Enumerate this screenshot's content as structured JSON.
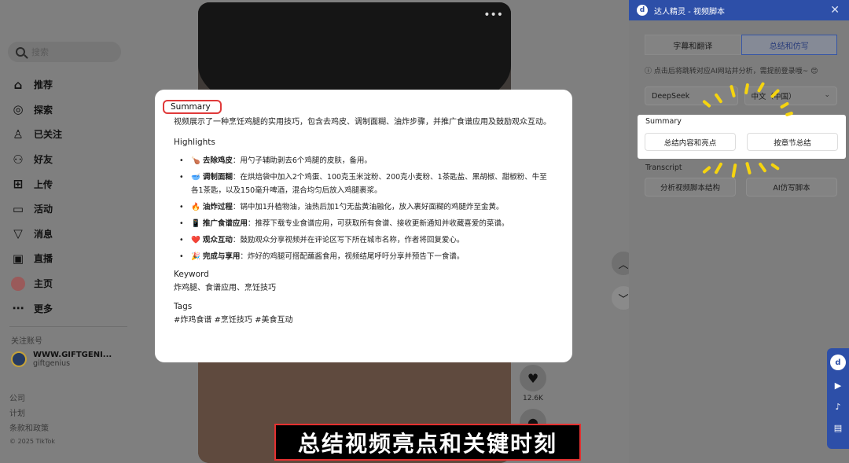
{
  "tiktok": {
    "search_placeholder": "搜索",
    "nav": [
      {
        "icon": "home-icon",
        "label": "推荐"
      },
      {
        "icon": "compass-icon",
        "label": "探索"
      },
      {
        "icon": "following-icon",
        "label": "已关注"
      },
      {
        "icon": "friends-icon",
        "label": "好友"
      },
      {
        "icon": "upload-icon",
        "label": "上传"
      },
      {
        "icon": "activity-icon",
        "label": "活动"
      },
      {
        "icon": "messages-icon",
        "label": "消息"
      },
      {
        "icon": "live-icon",
        "label": "直播"
      },
      {
        "icon": "profile-avatar",
        "label": "主页"
      },
      {
        "icon": "more-icon",
        "label": "更多"
      }
    ],
    "following_title": "关注账号",
    "account": {
      "name": "WWW.GIFTGENI...",
      "handle": "giftgenius"
    },
    "footer": [
      "公司",
      "计划",
      "条款和政策"
    ],
    "copyright": "© 2025 TikTok",
    "like_count": "12.6K"
  },
  "caption": "总结视频亮点和关键时刻",
  "card": {
    "summary_title": "Summary",
    "summary_text": "视频展示了一种烹饪鸡腿的实用技巧，包含去鸡皮、调制面糊、油炸步骤，并推广食谱应用及鼓励观众互动。",
    "highlights_title": "Highlights",
    "highlights": [
      {
        "emoji": "🍗",
        "title": "去除鸡皮",
        "text": "：用勺子辅助剥去6个鸡腿的皮肤，备用。"
      },
      {
        "emoji": "🥣",
        "title": "调制面糊",
        "text": "：在烘焙袋中加入2个鸡蛋、100克玉米淀粉、200克小麦粉、1茶匙盐、黑胡椒、甜椒粉、牛至各1茶匙，以及150毫升啤酒，混合均匀后放入鸡腿裹浆。"
      },
      {
        "emoji": "🔥",
        "title": "油炸过程",
        "text": "：锅中加1升植物油，油热后加1勺无盐黄油融化，放入裹好面糊的鸡腿炸至金黄。"
      },
      {
        "emoji": "📱",
        "title": "推广食谱应用",
        "text": "：推荐下载专业食谱应用，可获取所有食谱、接收更新通知并收藏喜爱的菜谱。"
      },
      {
        "emoji": "❤️",
        "title": "观众互动",
        "text": "：鼓励观众分享视频并在评论区写下所在城市名称，作者将回复爱心。"
      },
      {
        "emoji": "🎉",
        "title": "完成与享用",
        "text": "：炸好的鸡腿可搭配蘸酱食用，视频结尾呼吁分享并预告下一食谱。"
      }
    ],
    "keyword_title": "Keyword",
    "keyword_text": "炸鸡腿、食谱应用、烹饪技巧",
    "tags_title": "Tags",
    "tags_text": "#炸鸡食谱 #烹饪技巧 #美食互动"
  },
  "panel": {
    "title": "达人精灵 - 视频脚本",
    "logo_glyph": "d",
    "tabs": [
      "字幕和翻译",
      "总结和仿写"
    ],
    "notice": "ⓘ 点击后将跳转对应AI网站并分析，需提前登录哦~ 😊",
    "model": "DeepSeek",
    "language": "中文（中国）",
    "summary_label": "Summary",
    "summary_buttons": [
      "总结内容和亮点",
      "按章节总结"
    ],
    "transcript_label": "Transcript",
    "transcript_buttons": [
      "分析视频脚本结构",
      "AI仿写脚本"
    ]
  }
}
